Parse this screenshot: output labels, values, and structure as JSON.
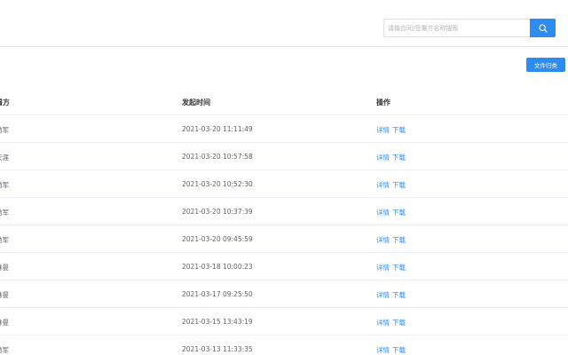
{
  "search": {
    "placeholder": "请输合同/签署方名称搜索"
  },
  "toolbar": {
    "archive_label": "文件归类"
  },
  "table": {
    "headers": {
      "party": "署方",
      "time": "发起时间",
      "actions": "操作"
    },
    "rows": [
      {
        "party": "勃军",
        "time": "2021-03-20 11:11:49",
        "detail": "详情",
        "download": "下载"
      },
      {
        "party": "天涯",
        "time": "2021-03-20 10:57:58",
        "detail": "详情",
        "download": "下载"
      },
      {
        "party": "勃军",
        "time": "2021-03-20 10:52:30",
        "detail": "详情",
        "download": "下载"
      },
      {
        "party": "勃军",
        "time": "2021-03-20 10:37:39",
        "detail": "详情",
        "download": "下载"
      },
      {
        "party": "勃军",
        "time": "2021-03-20 09:45:59",
        "detail": "详情",
        "download": "下载"
      },
      {
        "party": "琳曼",
        "time": "2021-03-18 10:00:23",
        "detail": "详情",
        "download": "下载"
      },
      {
        "party": "琳曼",
        "time": "2021-03-17 09:25:50",
        "detail": "详情",
        "download": "下载"
      },
      {
        "party": "琳曼",
        "time": "2021-03-15 13:43:19",
        "detail": "详情",
        "download": "下载"
      },
      {
        "party": "勃军",
        "time": "2021-03-13 11:33:35",
        "detail": "详情",
        "download": "下载"
      }
    ]
  },
  "colors": {
    "primary": "#2d8cf0",
    "border": "#ebeef5"
  },
  "icons": {
    "search": "search-icon"
  }
}
